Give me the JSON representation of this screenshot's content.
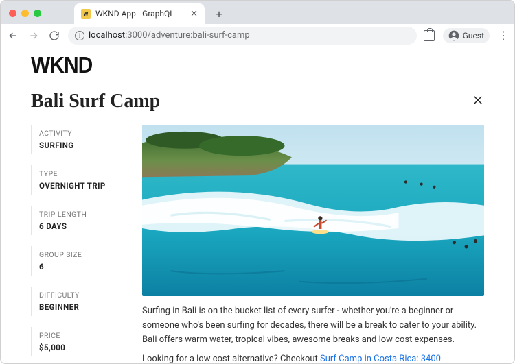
{
  "browser": {
    "tab_title": "WKND App - GraphQL",
    "url_host": "localhost",
    "url_port": ":3000",
    "url_path": "/adventure:bali-surf-camp",
    "guest_label": "Guest"
  },
  "brand": "WKND",
  "page_title": "Bali Surf Camp",
  "meta": [
    {
      "label": "ACTIVITY",
      "value": "SURFING"
    },
    {
      "label": "TYPE",
      "value": "OVERNIGHT TRIP"
    },
    {
      "label": "TRIP LENGTH",
      "value": "6 DAYS"
    },
    {
      "label": "GROUP SIZE",
      "value": "6"
    },
    {
      "label": "DIFFICULTY",
      "value": "BEGINNER"
    },
    {
      "label": "PRICE",
      "value": "$5,000"
    }
  ],
  "description": "Surfing in Bali is on the bucket list of every surfer - whether you're a beginner or someone who's been surfing for decades, there will be a break to cater to your ability. Bali offers warm water, tropical vibes, awesome breaks and low cost expenses.",
  "alt_prefix": "Looking for a low cost alternative? Checkout ",
  "alt_link_text": "Surf Camp in Costa Rica: 3400"
}
